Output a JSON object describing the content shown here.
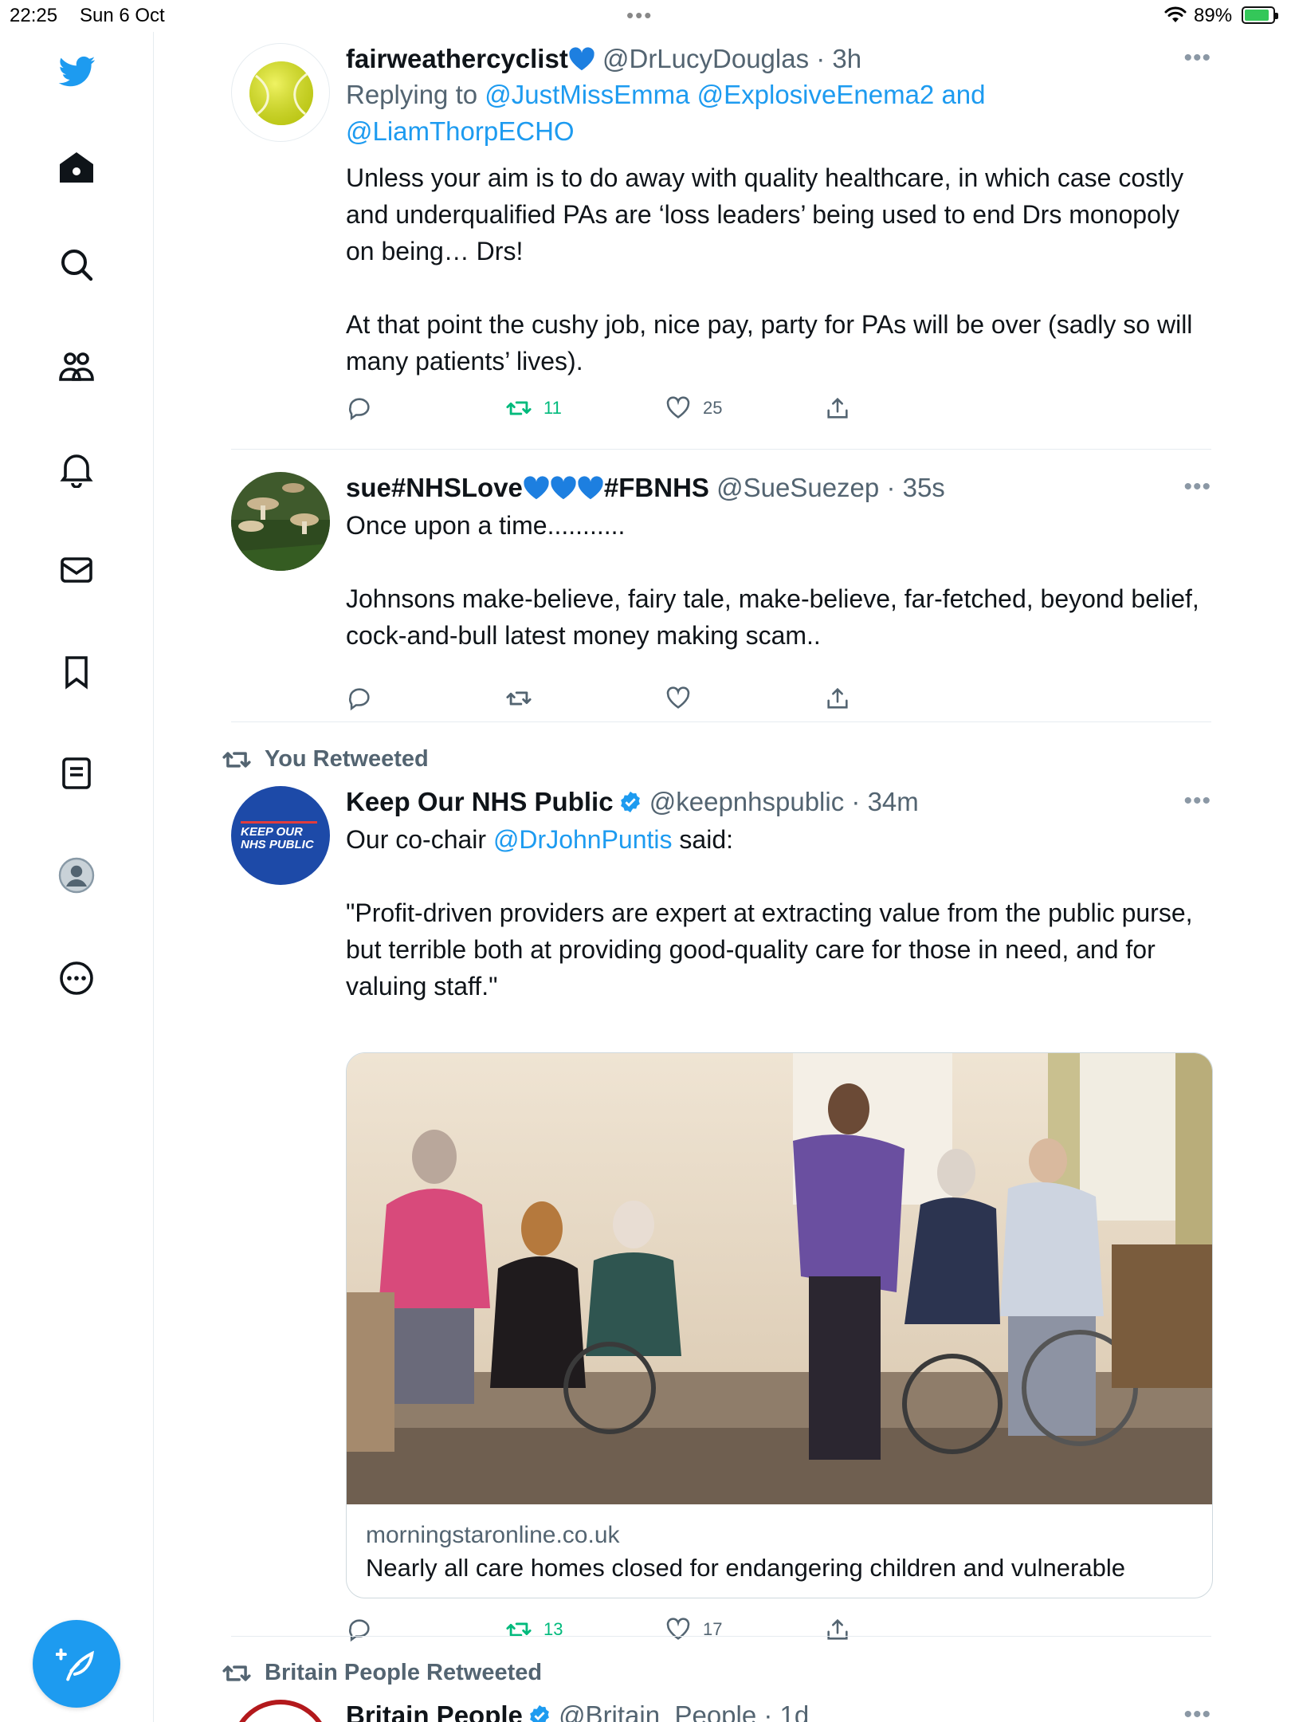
{
  "status_bar": {
    "time": "22:25",
    "date": "Sun 6 Oct",
    "battery": "89%",
    "battery_level": 0.89
  },
  "sidebar": {
    "items": [
      {
        "name": "twitter-logo"
      },
      {
        "name": "home"
      },
      {
        "name": "explore"
      },
      {
        "name": "communities"
      },
      {
        "name": "notifications"
      },
      {
        "name": "messages"
      },
      {
        "name": "bookmarks"
      },
      {
        "name": "lists"
      },
      {
        "name": "profile"
      },
      {
        "name": "more"
      }
    ],
    "accent": "#1d9bf0"
  },
  "tweets": [
    {
      "name": "fairweathercyclist",
      "handle": "@DrLucyDouglas",
      "time": "· 3h",
      "replying_prefix": "Replying to",
      "replying_to_1": "@JustMissEmma @ExplosiveEnema2",
      "replying_and": "and",
      "replying_to_2": "@LiamThorpECHO",
      "body": "Unless your aim is to do away with quality healthcare, in which case costly and underqualified PAs are ‘loss leaders’ being used to end Drs monopoly on being… Drs!\n\nAt that point the cushy job, nice pay, party for PAs will be over (sadly so will many patients’ lives).",
      "retweets": "11",
      "likes": "25"
    },
    {
      "name": "sue#NHSLove",
      "name_suffix": "#FBNHS",
      "handle": "@SueSuezep",
      "time": "· 35s",
      "body": "Once upon a time...........\n\nJohnsons make-believe, fairy tale, make-believe, far-fetched, beyond belief, cock-and-bull latest money making scam.."
    },
    {
      "retweeted_by": "You Retweeted",
      "name": "Keep Our NHS Public",
      "handle": "@keepnhspublic",
      "time": "· 34m",
      "avatar_text_1": "KEEP OUR",
      "avatar_text_2": "NHS PUBLIC",
      "body_prefix": "Our co-chair",
      "mention": "@DrJohnPuntis",
      "body_suffix": "said:",
      "body": "\"Profit-driven providers are expert at extracting value from the public purse, but terrible both at providing good-quality care for those in need, and for valuing staff.\"",
      "card_domain": "morningstaronline.co.uk",
      "card_title": "Nearly all care homes closed for endangering children and vulnerable",
      "retweets": "13",
      "likes": "17"
    },
    {
      "retweeted_by": "Britain People Retweeted",
      "name": "Britain People",
      "handle": "@Britain_People",
      "time": "· 1d"
    }
  ]
}
